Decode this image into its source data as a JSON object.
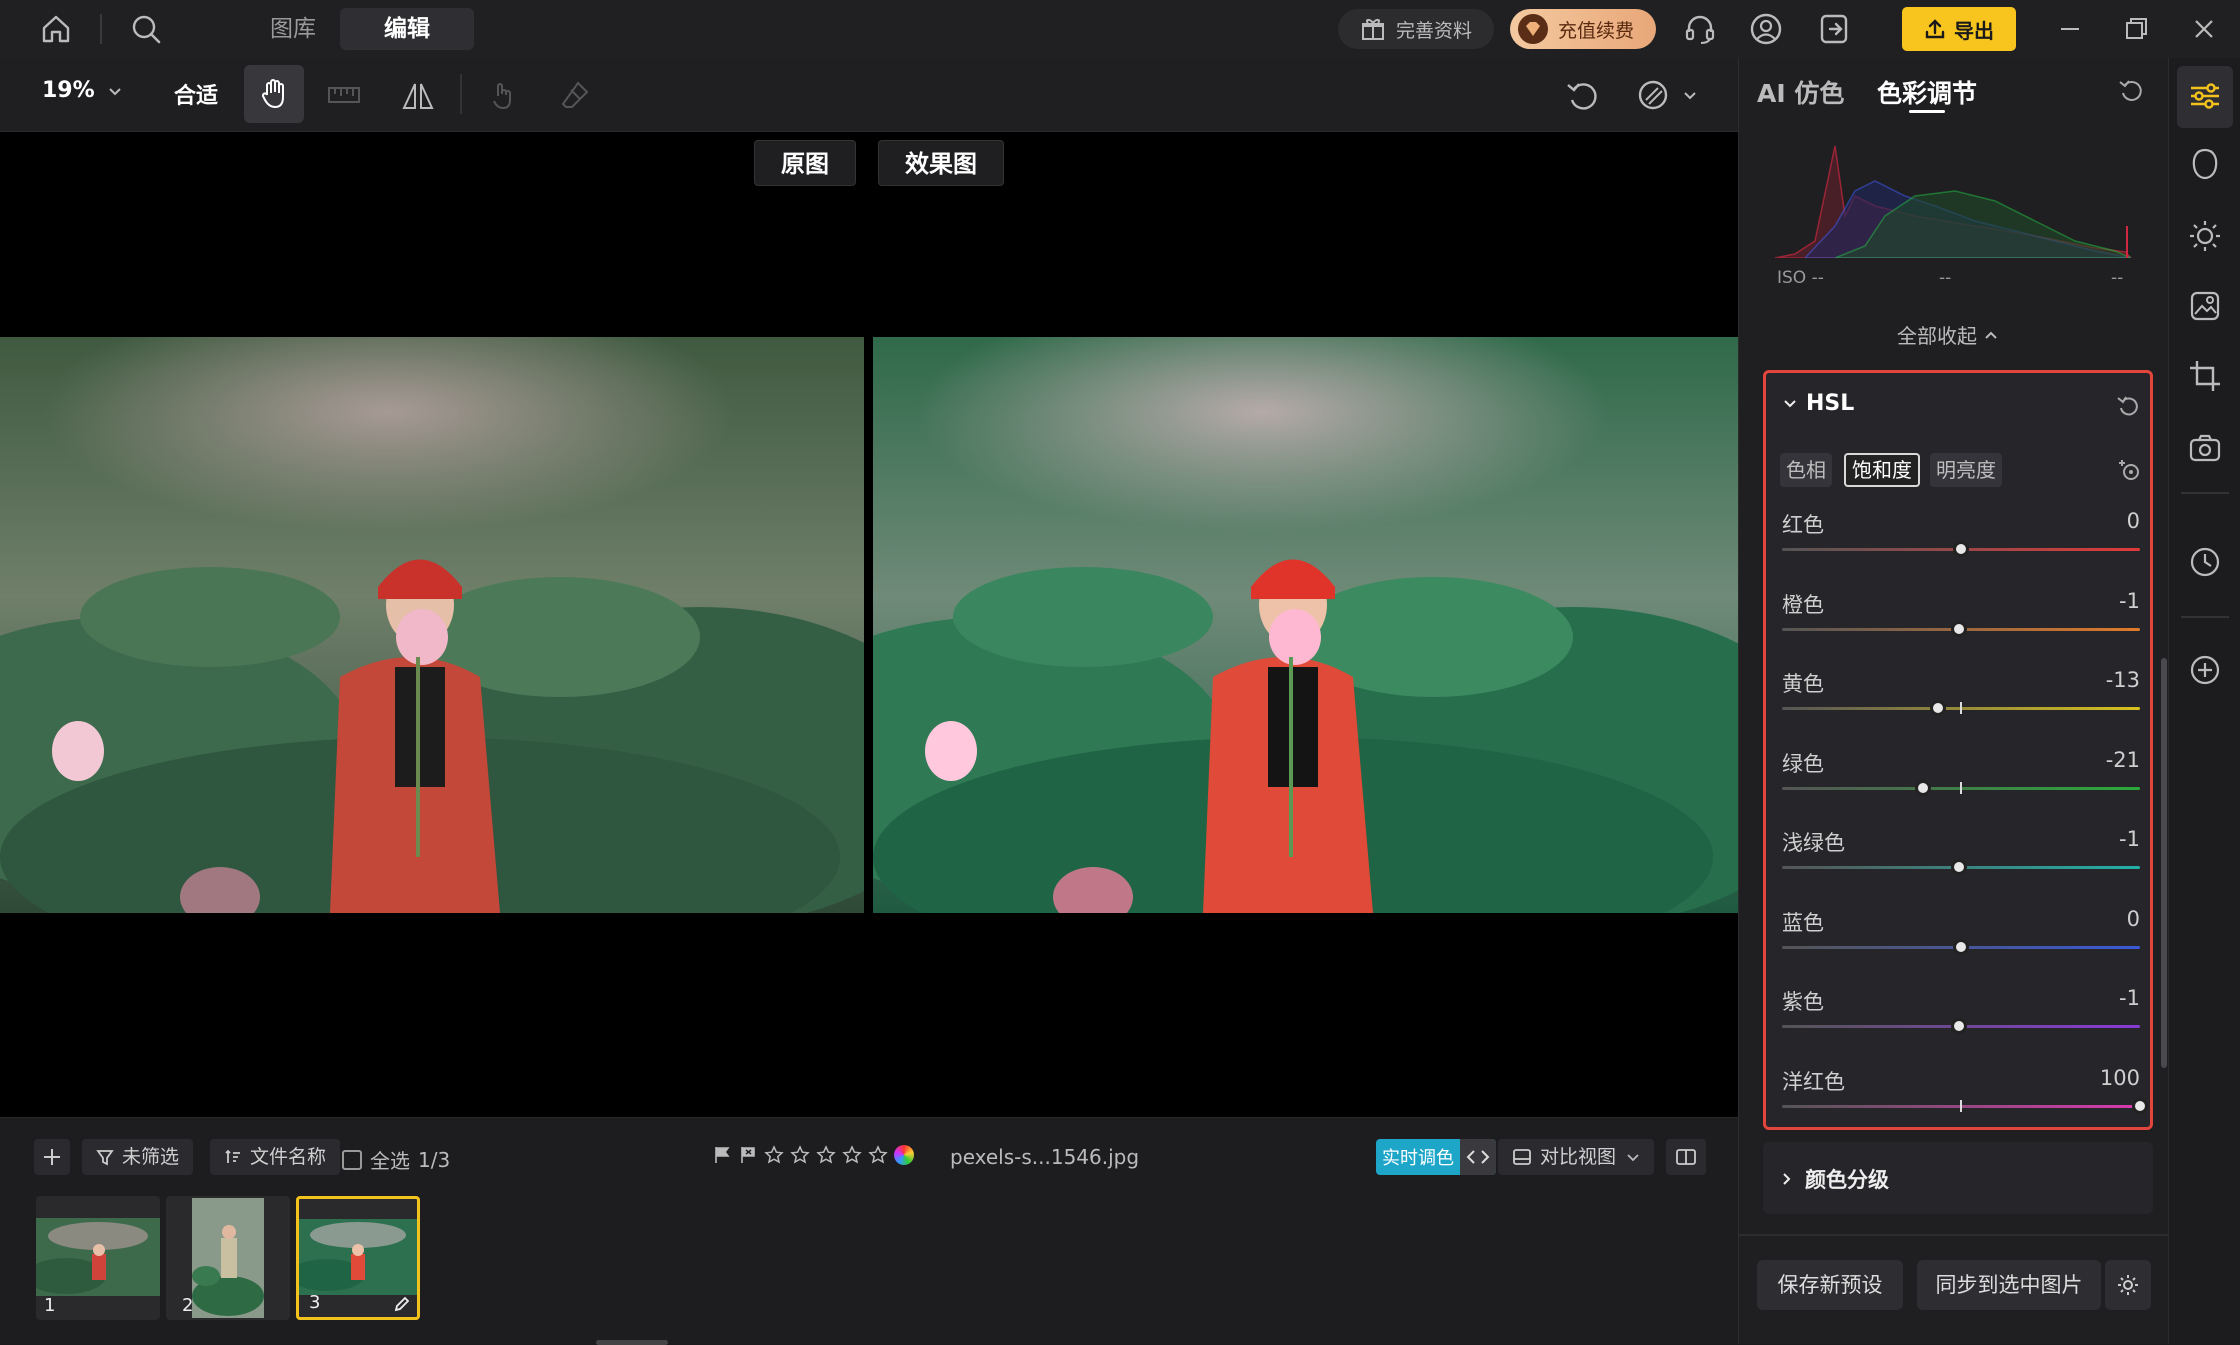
{
  "topbar": {
    "nav_library": "图库",
    "nav_edit": "编辑",
    "complete_profile": "完善资料",
    "recharge": "充值续费",
    "export": "导出"
  },
  "toolbar": {
    "zoom": "19%",
    "fit": "合适"
  },
  "canvas": {
    "original_label": "原图",
    "effect_label": "效果图"
  },
  "bottombar": {
    "filter": "未筛选",
    "sort": "文件名称",
    "select_all": "全选",
    "selection_count": "1/3",
    "rating_stars": 0,
    "filename": "pexels-s...1546.jpg",
    "live_adjust": "实时调色",
    "compare_view": "对比视图",
    "thumbnails": [
      {
        "index": "1",
        "selected": false
      },
      {
        "index": "2",
        "selected": false
      },
      {
        "index": "3",
        "selected": true
      }
    ]
  },
  "panel": {
    "tab_ai": "AI 仿色",
    "tab_color": "色彩调节",
    "histogram": {
      "iso": "ISO --",
      "shutter": "--",
      "aperture": "--"
    },
    "collapse_all": "全部收起",
    "hsl": {
      "title": "HSL",
      "tabs": [
        "色相",
        "饱和度",
        "明亮度"
      ],
      "active_tab": 1,
      "sliders": [
        {
          "name": "红色",
          "value": "0",
          "color": "#e03a3a"
        },
        {
          "name": "橙色",
          "value": "-1",
          "color": "#e07a2a"
        },
        {
          "name": "黄色",
          "value": "-13",
          "color": "#d8c21e"
        },
        {
          "name": "绿色",
          "value": "-21",
          "color": "#2aaa3a"
        },
        {
          "name": "浅绿色",
          "value": "-1",
          "color": "#22b0a8"
        },
        {
          "name": "蓝色",
          "value": "0",
          "color": "#3a58d8"
        },
        {
          "name": "紫色",
          "value": "-1",
          "color": "#8a3ad8"
        },
        {
          "name": "洋红色",
          "value": "100",
          "color": "#d83ab0"
        }
      ]
    },
    "color_grading": "颜色分级",
    "save_preset": "保存新预设",
    "sync": "同步到选中图片"
  }
}
